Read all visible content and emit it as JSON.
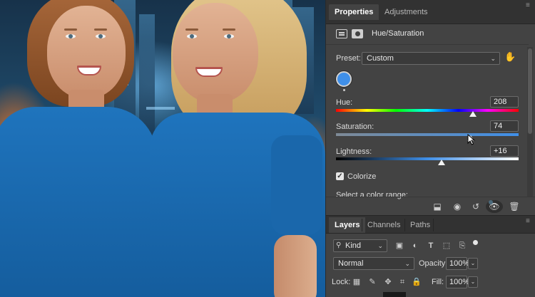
{
  "properties_panel": {
    "tabs": [
      {
        "label": "Properties",
        "active": true
      },
      {
        "label": "Adjustments",
        "active": false
      }
    ],
    "adjustment_title": "Hue/Saturation",
    "header_icons": [
      "adjustment-layer-icon",
      "layer-mask-icon"
    ],
    "preset": {
      "label": "Preset:",
      "value": "Custom"
    },
    "color_swatch": "#3f8fe8",
    "hue": {
      "label": "Hue:",
      "value": "208",
      "fraction": 0.75
    },
    "saturation": {
      "label": "Saturation:",
      "value": "74",
      "fraction": 0.74
    },
    "lightness": {
      "label": "Lightness:",
      "value": "+16",
      "fraction": 0.58
    },
    "colorize": {
      "label": "Colorize",
      "checked": true
    },
    "range_label": "Select a color range:"
  },
  "layers_panel": {
    "tabs": [
      {
        "label": "Layers",
        "active": true
      },
      {
        "label": "Channels",
        "active": false
      },
      {
        "label": "Paths",
        "active": false
      }
    ],
    "filter_kind": "Kind",
    "filter_icons": [
      "image-filter-icon",
      "adjustment-filter-icon",
      "type-filter-icon",
      "shape-filter-icon",
      "smart-object-filter-icon"
    ],
    "blend_mode": "Normal",
    "opacity": {
      "label": "Opacity:",
      "value": "100%"
    },
    "lock_label": "Lock:",
    "lock_icons": [
      "lock-pixels-icon",
      "lock-image-icon",
      "lock-position-icon",
      "lock-artboard-icon",
      "lock-all-icon"
    ],
    "fill": {
      "label": "Fill:",
      "value": "100%"
    }
  },
  "colors": {
    "shirt": "#1f74bd",
    "panel_bg": "#434343",
    "accent_blue": "#3f8fe8"
  }
}
